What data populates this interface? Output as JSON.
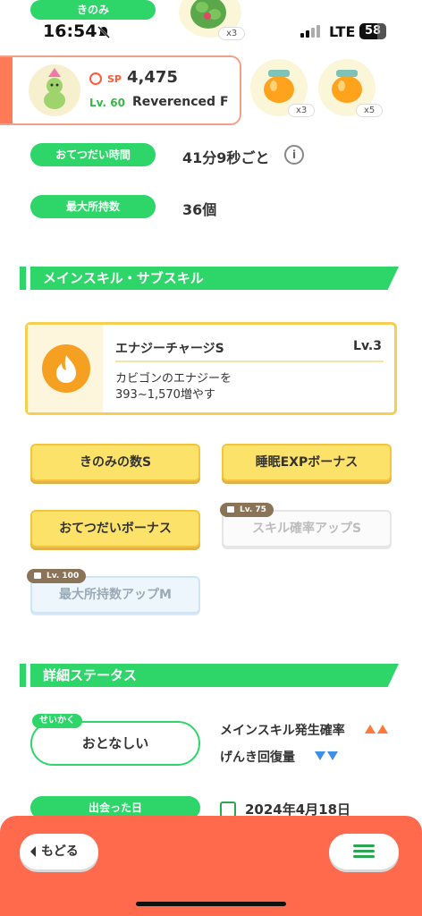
{
  "status_bar": {
    "time": "16:54",
    "network": "LTE",
    "battery": "58"
  },
  "top": {
    "berry_label": "きのみ",
    "ingredients": [
      {
        "icon": "green-plant-icon",
        "qty": "x3"
      },
      {
        "icon": "honey-jar-icon",
        "qty": "x3"
      },
      {
        "icon": "honey-jar-icon",
        "qty": "x5"
      }
    ]
  },
  "pokemon": {
    "sp_label": "SP",
    "sp_value": "4,475",
    "level": "Lv. 60",
    "name": "Reverenced F"
  },
  "stats": [
    {
      "label": "おてつだい時間",
      "value": "41分9秒ごと"
    },
    {
      "label": "最大所持数",
      "value": "36個"
    }
  ],
  "info_icon": "i",
  "skills_section": {
    "title": "メインスキル・サブスキル"
  },
  "main_skill": {
    "name": "エナジーチャージS",
    "level": "Lv.3",
    "desc_line1": "カビゴンのエナジーを",
    "desc_line2": "393~1,570増やす"
  },
  "sub_skills": [
    {
      "label": "きのみの数S",
      "locked": false
    },
    {
      "label": "睡眠EXPボーナス",
      "locked": false
    },
    {
      "label": "おてつだいボーナス",
      "locked": false
    },
    {
      "label": "スキル確率アップS",
      "locked": true,
      "unlock": "Lv. 75"
    },
    {
      "label": "最大所持数アップM",
      "locked": true,
      "unlock": "Lv. 100"
    }
  ],
  "detail_section": {
    "title": "詳細ステータス"
  },
  "nature": {
    "tag": "せいかく",
    "value": "おとなしい",
    "up_label": "メインスキル発生確率",
    "down_label": "げんき回復量"
  },
  "met": {
    "label": "出会った日",
    "date": "2024年4月18日"
  },
  "nav": {
    "back_label": "もどる"
  },
  "colors": {
    "green": "#2ed66a",
    "orange": "#ff6a4d",
    "yellow": "#fde26a"
  }
}
